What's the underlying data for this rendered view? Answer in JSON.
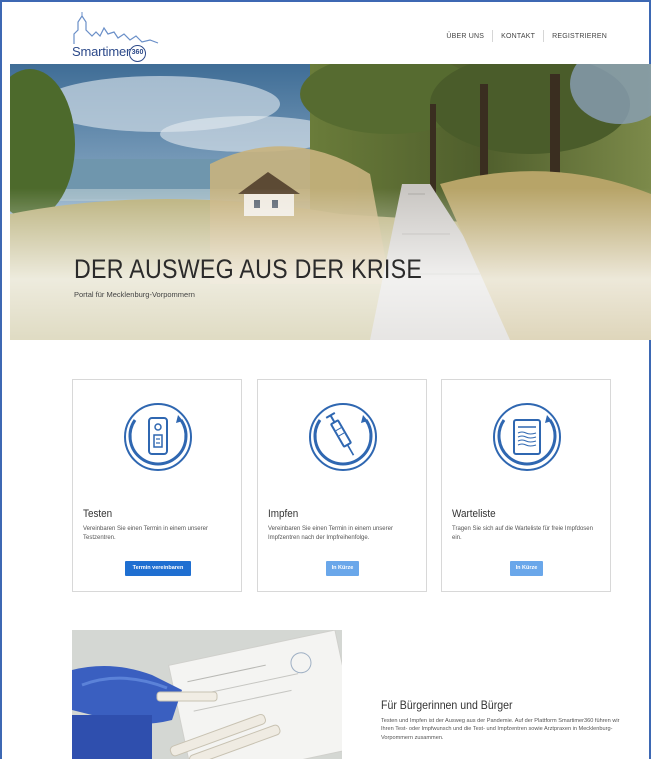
{
  "brand": {
    "name": "Smartimer",
    "badge": "360"
  },
  "nav": {
    "items": [
      "ÜBER UNS",
      "KONTAKT",
      "REGISTRIEREN"
    ]
  },
  "hero": {
    "title": "DER AUSWEG AUS DER KRISE",
    "subtitle": "Portal für Mecklenburg-Vorpommern"
  },
  "cards": [
    {
      "title": "Testen",
      "text": "Vereinbaren Sie einen Termin in einem unserer Testzentren.",
      "button": "Termin vereinbaren",
      "icon": "test-kit-icon"
    },
    {
      "title": "Impfen",
      "text": "Vereinbaren Sie einen Termin in einem unserer Impfzentren nach der Impfreihenfolge.",
      "button": "In Kürze",
      "icon": "syringe-icon"
    },
    {
      "title": "Warteliste",
      "text": "Tragen Sie sich auf die Warteliste für freie Impfdosen ein.",
      "button": "In Kürze",
      "icon": "waitlist-document-icon"
    }
  ],
  "citizens": {
    "title": "Für Bürgerinnen und Bürger",
    "text": "Testen und Impfen ist der Ausweg aus der Pandemie. Auf der Plattform Smartimer360 führen wir Ihren Test- oder Impfwunsch und die Test- und Impfzentren sowie Arztpraxen in Mecklenburg-Vorpommern zusammen."
  },
  "colors": {
    "primary": "#1f6fd1",
    "muted_button": "#6aa7ea",
    "icon_blue": "#2f67b1",
    "frame": "#3d68b3"
  }
}
